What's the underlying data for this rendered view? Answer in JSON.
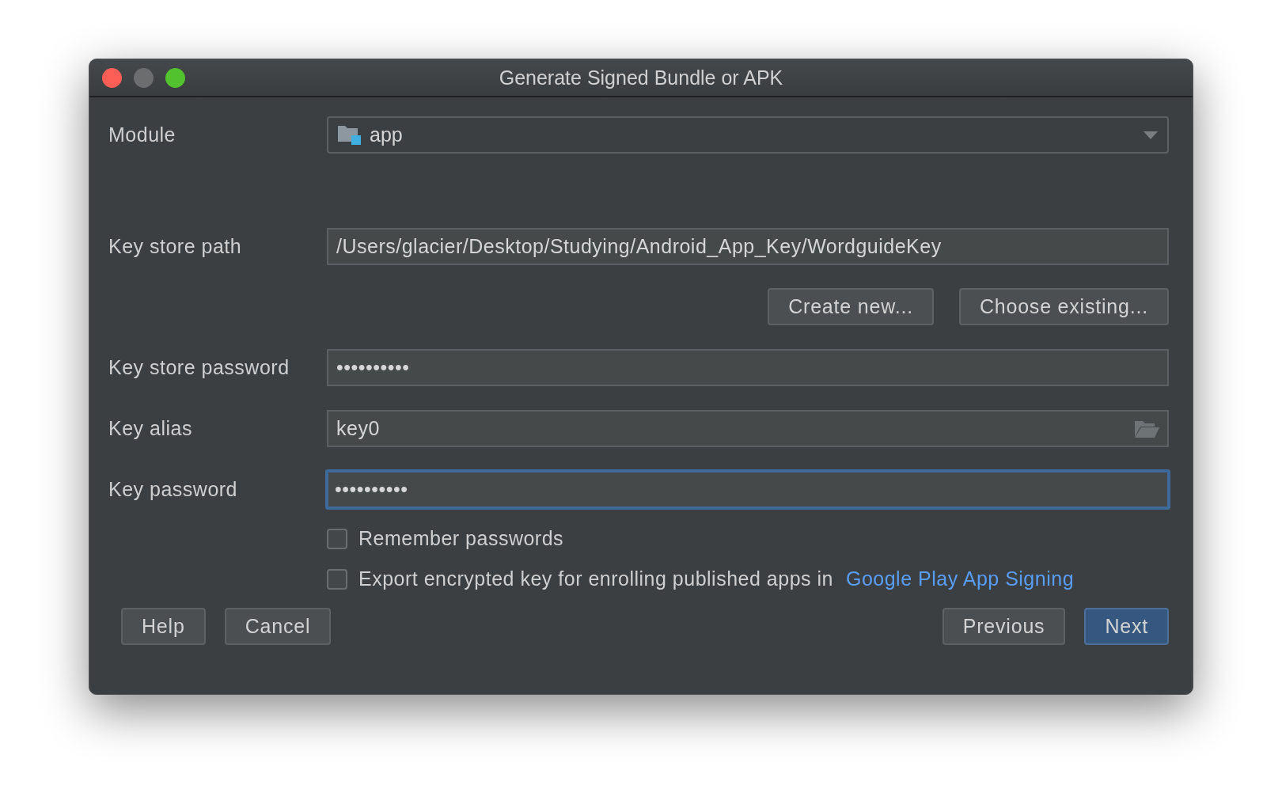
{
  "window": {
    "title": "Generate Signed Bundle or APK"
  },
  "module": {
    "label": "Module",
    "value": "app"
  },
  "fields": [
    {
      "label": "Key store path",
      "value": "/Users/glacier/Desktop/Studying/Android_App_Key/WordguideKey",
      "focused": false,
      "kind": "text"
    },
    {
      "label": "Key store password",
      "value": "••••••••••",
      "focused": false,
      "kind": "text"
    },
    {
      "label": "Key alias",
      "value": "key0",
      "focused": false,
      "kind": "browse"
    },
    {
      "label": "Key password",
      "value": "••••••••••",
      "focused": true,
      "kind": "text"
    }
  ],
  "keystore_buttons": [
    "Create new...",
    "Choose existing..."
  ],
  "options": [
    {
      "label": "Remember passwords",
      "checked": false
    },
    {
      "label": "Export encrypted key for enrolling published apps in",
      "checked": false,
      "link": "Google Play App Signing"
    }
  ],
  "left_buttons": [
    {
      "label": "Help",
      "default": false
    },
    {
      "label": "Cancel",
      "default": false
    }
  ],
  "right_buttons": [
    {
      "label": "Previous",
      "default": false
    },
    {
      "label": "Next",
      "default": true
    }
  ]
}
